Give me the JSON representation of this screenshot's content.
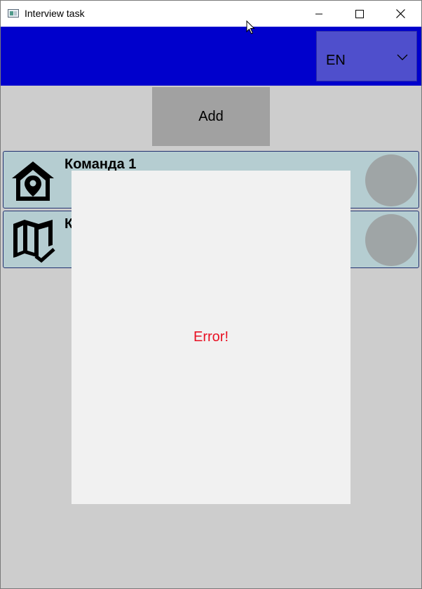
{
  "window": {
    "title": "Interview task"
  },
  "header": {
    "language": {
      "selected": "EN"
    }
  },
  "main": {
    "add_button_label": "Add",
    "items": [
      {
        "label": "Команда 1",
        "icon": "home-pin-icon"
      },
      {
        "label": "К",
        "icon": "map-check-icon"
      }
    ]
  },
  "modal": {
    "message": "Error!"
  },
  "colors": {
    "header_blue": "#0000cc",
    "dropdown": "#4f4fcc",
    "error_text": "#e81123",
    "item_bg": "#b5cdd1"
  }
}
